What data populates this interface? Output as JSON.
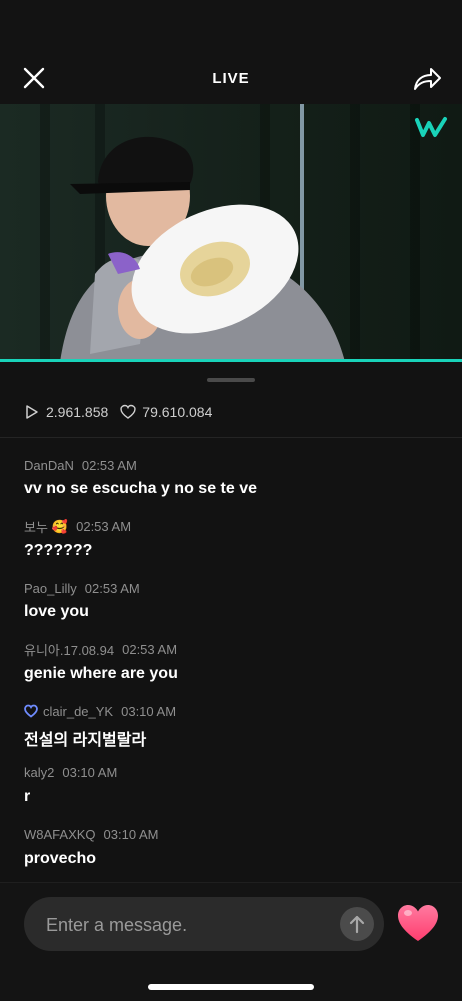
{
  "header": {
    "title": "LIVE"
  },
  "stats": {
    "plays": "2.961.858",
    "likes": "79.610.084"
  },
  "chat": [
    {
      "user": "DanDaN",
      "time": "02:53 AM",
      "text": "vv no se escucha y no se te ve"
    },
    {
      "user": "보누",
      "emoji": "🥰",
      "time": "02:53 AM",
      "text": "???????"
    },
    {
      "user": "Pao_Lilly",
      "time": "02:53 AM",
      "text": "love you"
    },
    {
      "user": "유니아.17.08.94",
      "time": "02:53 AM",
      "text": "genie where are you"
    },
    {
      "user": "clair_de_YK",
      "time": "03:10 AM",
      "text": "전설의 라지벌랄라",
      "badge": "heart-badge-icon"
    },
    {
      "user": "kaly2",
      "time": "03:10 AM",
      "text": "r"
    },
    {
      "user": "W8AFAXKQ",
      "time": "03:10 AM",
      "text": "provecho"
    }
  ],
  "composer": {
    "placeholder": "Enter a message."
  },
  "colors": {
    "accent": "#19d3b9",
    "heart": "#ff4f7b"
  }
}
